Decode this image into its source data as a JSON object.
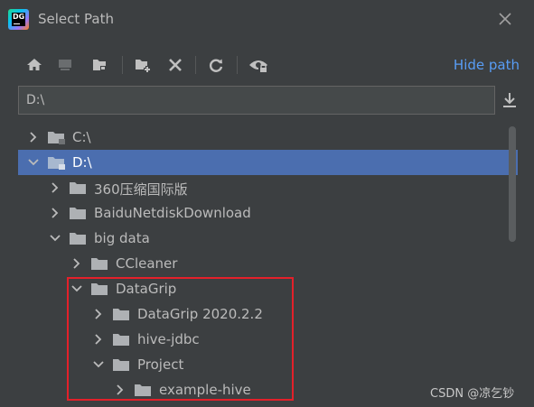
{
  "window": {
    "app_logo_text": "DG",
    "title": "Select Path"
  },
  "toolbar": {
    "buttons": [
      {
        "name": "home-icon",
        "tooltip": ""
      },
      {
        "name": "desktop-icon",
        "tooltip": ""
      },
      {
        "name": "project-folder-icon",
        "tooltip": ""
      },
      {
        "name": "new-folder-icon",
        "tooltip": ""
      },
      {
        "name": "delete-icon",
        "tooltip": ""
      },
      {
        "name": "refresh-icon",
        "tooltip": ""
      },
      {
        "name": "show-hidden-icon",
        "tooltip": ""
      }
    ],
    "hide_path_label": "Hide path"
  },
  "path_input": {
    "value": "D:\\"
  },
  "tree": {
    "rows": [
      {
        "label": "C:\\",
        "expanded": false,
        "selected": false,
        "level": 0,
        "drive": true
      },
      {
        "label": "D:\\",
        "expanded": true,
        "selected": true,
        "level": 0,
        "drive": true
      },
      {
        "label": "360压缩国际版",
        "expanded": false,
        "selected": false,
        "level": 1
      },
      {
        "label": "BaiduNetdiskDownload",
        "expanded": false,
        "selected": false,
        "level": 1
      },
      {
        "label": "big data",
        "expanded": true,
        "selected": false,
        "level": 1
      },
      {
        "label": "CCleaner",
        "expanded": false,
        "selected": false,
        "level": 2
      },
      {
        "label": "DataGrip",
        "expanded": true,
        "selected": false,
        "level": 2
      },
      {
        "label": "DataGrip 2020.2.2",
        "expanded": false,
        "selected": false,
        "level": 3
      },
      {
        "label": "hive-jdbc",
        "expanded": false,
        "selected": false,
        "level": 3
      },
      {
        "label": "Project",
        "expanded": true,
        "selected": false,
        "level": 3
      },
      {
        "label": "example-hive",
        "expanded": false,
        "selected": false,
        "level": 4
      }
    ]
  },
  "colors": {
    "background": "#3c3f41",
    "selection": "#4b6eaf",
    "link": "#589df6",
    "annotation": "#e3202a"
  },
  "watermark": "CSDN @凉乞钞"
}
